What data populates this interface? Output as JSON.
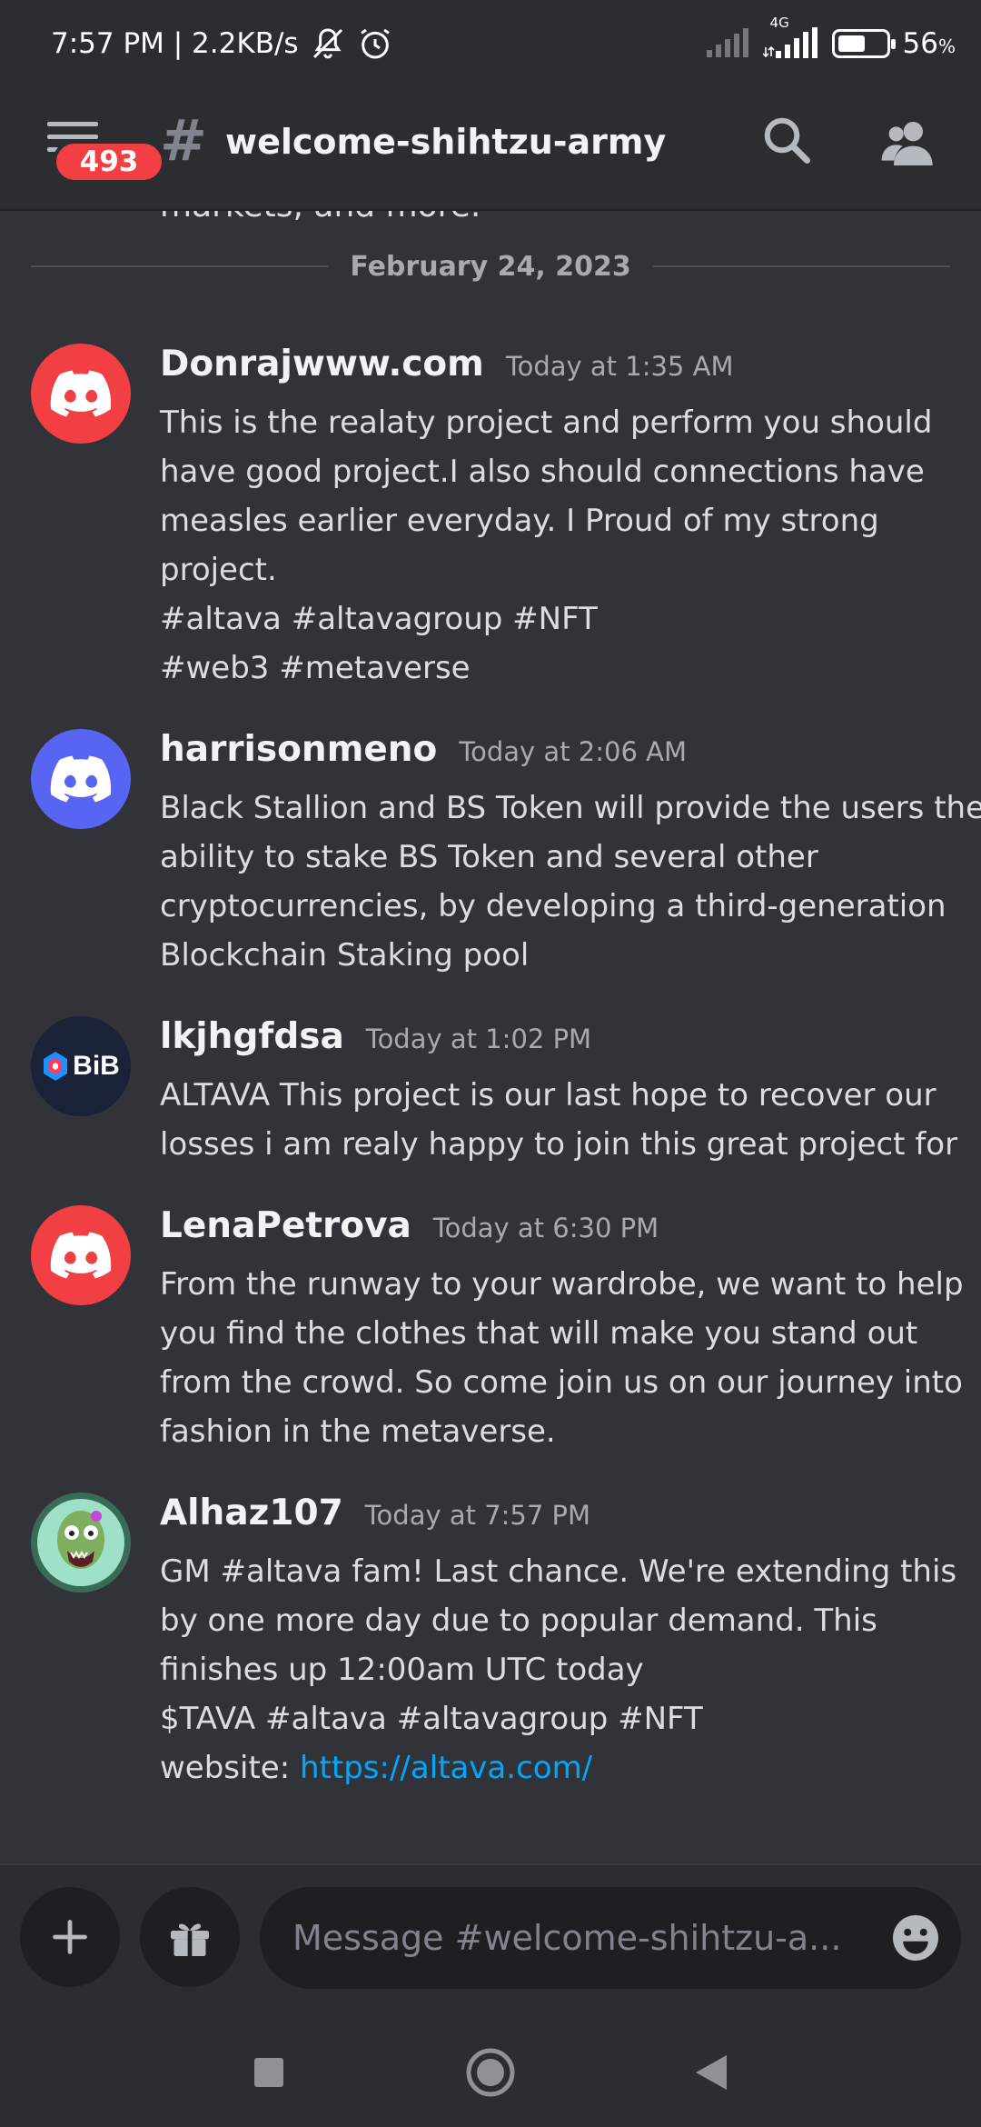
{
  "status_bar": {
    "time_speed": "7:57 PM | 2.2KB/s",
    "network": "4G",
    "battery_percent": "56",
    "battery_unit": "%",
    "battery_level": 0.56
  },
  "header": {
    "unread_badge": "493",
    "channel_name": "welcome-shihtzu-army"
  },
  "messages_area": {
    "cutoff_text": "markets, and more.",
    "date_divider": "February 24, 2023"
  },
  "messages": [
    {
      "author": "Donrajwww.com",
      "timestamp": "Today at 1:35 AM",
      "avatar_color": "#f23f43",
      "lines": [
        "This is the realaty project and perform you should",
        "have good project.I also should connections have",
        "measles earlier everyday. I Proud of my strong",
        "project.",
        "#altava #altavagroup #NFT",
        "#web3 #metaverse"
      ]
    },
    {
      "author": "harrisonmeno",
      "timestamp": "Today at 2:06 AM",
      "avatar_color": "#5865f2",
      "lines": [
        "Black Stallion and BS Token will provide the users the",
        "ability to stake BS Token and several other",
        "cryptocurrencies, by developing a third-generation",
        "Blockchain Staking pool"
      ]
    },
    {
      "author": "lkjhgfdsa",
      "timestamp": "Today at 1:02 PM",
      "avatar_color": "#1a2238",
      "avatar_text": "BiB",
      "lines": [
        "ALTAVA This project is our last hope to recover our",
        "losses i am realy happy to join this great project for"
      ]
    },
    {
      "author": "LenaPetrova",
      "timestamp": "Today at 6:30 PM",
      "avatar_color": "#f23f43",
      "lines": [
        "From the runway to your wardrobe, we want to help",
        "you find the clothes that will make you stand out",
        "from the crowd. So come join us on our journey into",
        "fashion in the metaverse."
      ]
    },
    {
      "author": "Alhaz107",
      "timestamp": "Today at 7:57 PM",
      "avatar_color": "#3a6b57",
      "lines": [
        "GM #altava fam! Last chance. We're extending this",
        "by one more day due to popular demand. This",
        "finishes up 12:00am UTC today",
        "$TAVA #altava #altavagroup #NFT"
      ],
      "link_prefix": "website: ",
      "link_text": "https://altava.com/"
    }
  ],
  "composer": {
    "placeholder": "Message #welcome-shihtzu-a..."
  },
  "colors": {
    "background": "#323339",
    "header": "#2b2d31",
    "link": "#00a8fc",
    "badge": "#f23f43"
  }
}
